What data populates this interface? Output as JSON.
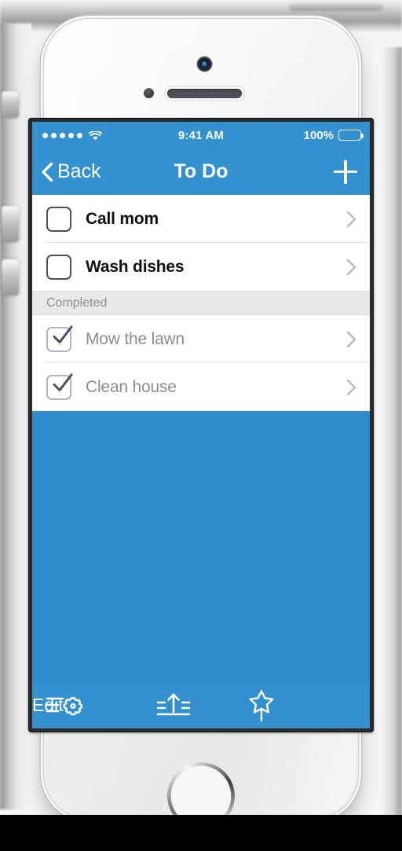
{
  "device": {
    "name": "iphone-5s-white-silver",
    "camera_icon": "front-camera",
    "sensor_icon": "proximity-sensor",
    "speaker_icon": "earpiece-speaker",
    "home_icon": "home-button"
  },
  "status_bar": {
    "signal_dots": 5,
    "signal_icon": "signal-strength-dots",
    "wifi_icon": "wifi-icon",
    "time": "9:41 AM",
    "battery_percent": "100%",
    "battery_icon": "battery-full-icon"
  },
  "nav_bar": {
    "back_label": "Back",
    "back_icon": "chevron-left-icon",
    "title": "To Do",
    "add_icon": "plus-icon"
  },
  "list": {
    "items": [
      {
        "label": "Call mom",
        "checked": false,
        "accessory_icon": "chevron-right-icon"
      },
      {
        "label": "Wash dishes",
        "checked": false,
        "accessory_icon": "chevron-right-icon"
      }
    ],
    "section_header": "Completed",
    "completed_items": [
      {
        "label": "Mow the lawn",
        "checked": true,
        "accessory_icon": "chevron-right-icon"
      },
      {
        "label": "Clean house",
        "checked": true,
        "accessory_icon": "chevron-right-icon"
      }
    ]
  },
  "toolbar": {
    "settings_icon": "list-settings-icon",
    "share_icon": "export-up-icon",
    "wand_icon": "magic-wand-icon",
    "edit_label": "Edit"
  },
  "colors": {
    "accent_blue": "#3391cf",
    "background_blue": "#2e8ccb",
    "section_gray": "#e9e9e9",
    "completed_text": "#8b8d90",
    "checkbox_border": "#4a515c"
  }
}
